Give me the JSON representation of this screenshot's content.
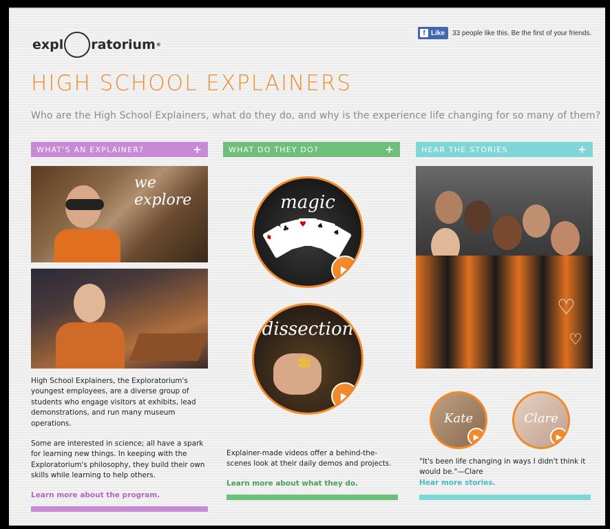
{
  "logo": {
    "left": "expl",
    "right": "ratorium",
    "mark": "®"
  },
  "facebook": {
    "like_label": "Like",
    "fb_glyph": "f",
    "text": "33 people like this. Be the first of your friends."
  },
  "page": {
    "title": "HIGH SCHOOL EXPLAINERS",
    "subtitle": "Who are the High School Explainers, what do they do, and why is the experience life changing for so many of them?"
  },
  "columns": {
    "explainer": {
      "header": "WHAT'S AN EXPLAINER?",
      "plus": "+",
      "photo_scrawl": "we explore",
      "paragraph1": "High School Explainers, the Exploratorium's youngest employees, are a diverse group of students who engage visitors at exhibits, lead demonstrations, and run many museum operations.",
      "paragraph2": "Some are interested in science; all have a spark for learning new things. In keeping with the Exploratorium's philosophy, they build their own skills while learning to help others.",
      "link": "Learn more about the program.",
      "color": "#c88ad6"
    },
    "do": {
      "header": "WHAT DO THEY DO?",
      "plus": "+",
      "video1_word": "magic",
      "video2_word": "dissection",
      "text": "Explainer-made videos offer a behind-the-scenes look at their daily demos and projects.",
      "link": "Learn more about what they do.",
      "color": "#6dbf7a"
    },
    "stories": {
      "header": "HEAR THE STORIES",
      "plus": "+",
      "avatar1_name": "Kate",
      "avatar2_name": "Clare",
      "quote": "\"It's been life changing in ways I didn't think it would be.\"—Clare",
      "link": "Hear more stories.",
      "color": "#7ed6d6"
    }
  },
  "icons": {
    "play": "play-icon",
    "plus": "plus-icon",
    "facebook": "facebook-icon"
  },
  "accent_color": "#f08a2a"
}
